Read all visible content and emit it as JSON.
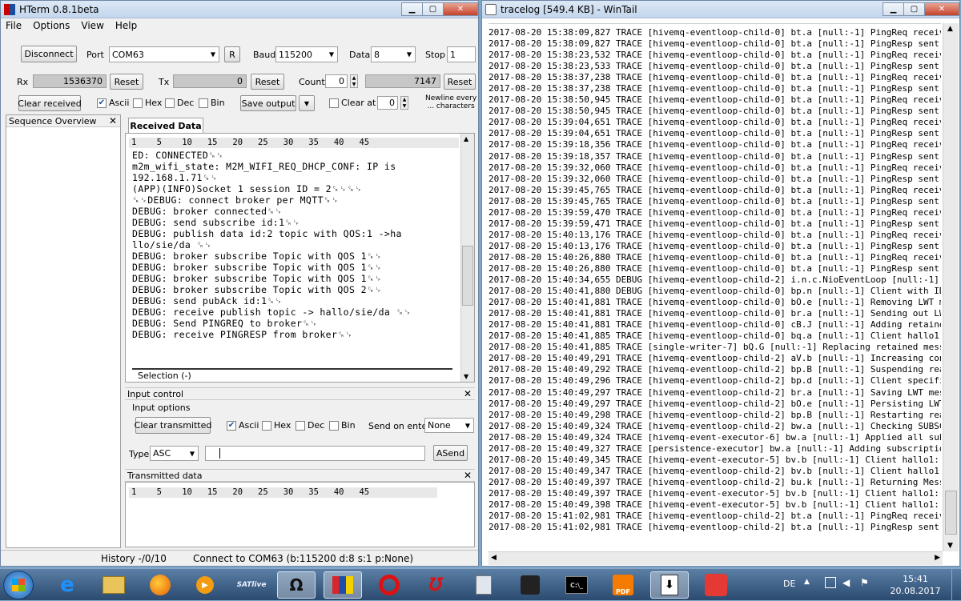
{
  "hterm": {
    "title": "HTerm 0.8.1beta",
    "menu": [
      "File",
      "Options",
      "View",
      "Help"
    ],
    "conn": {
      "disconnect_label": "Disconnect",
      "port_label": "Port",
      "port_value": "COM63",
      "r_label": "R",
      "baud_label": "Baud",
      "baud_value": "115200",
      "data_label": "Data",
      "data_value": "8",
      "stop_label": "Stop",
      "stop_value": "1"
    },
    "counters": {
      "rx_label": "Rx",
      "rx_value": "1536370",
      "rx_reset": "Reset",
      "tx_label": "Tx",
      "tx_value": "0",
      "tx_reset": "Reset",
      "count_label": "Count",
      "count_value": "0",
      "count_total": "7147",
      "count_reset": "Reset"
    },
    "rxopts": {
      "clear_received": "Clear received",
      "ascii": "Ascii",
      "hex": "Hex",
      "dec": "Dec",
      "bin": "Bin",
      "save_output": "Save output",
      "clear_at": "Clear at",
      "clear_at_value": "0",
      "newline_1": "Newline every",
      "newline_2": "... characters"
    },
    "sequence_overview": "Sequence Overview",
    "received_tab": "Received Data",
    "ruler": "1    5    10   15   20   25   30   35   40   45",
    "received_lines": [
      "ED: CONNECTED␍␊",
      "m2m_wifi_state: M2M_WIFI_REQ_DHCP_CONF: IP is",
      "192.168.1.71␍␊",
      "(APP)(INFO)Socket 1 session ID = 2␍␊␍␊",
      "␍␊DEBUG: connect broker per MQTT␍␊",
      "DEBUG: broker connected␍␊",
      "DEBUG: send subscribe id:1␍␊",
      "DEBUG: publish data id:2 topic with QOS:1 ->ha",
      "llo/sie/da ␍␊",
      "DEBUG: broker subscribe Topic with QOS 1␍␊",
      "DEBUG: broker subscribe Topic with QOS 1␍␊",
      "DEBUG: broker subscribe Topic with QOS 1␍␊",
      "DEBUG: broker subscribe Topic with QOS 2␍␊",
      "DEBUG: send pubAck id:1␍␊",
      "DEBUG: receive publish topic -> hallo/sie/da ␍␊",
      "DEBUG: Send PINGREQ to broker␍␊",
      "DEBUG: receive PINGRESP from broker␍␊"
    ],
    "selection": "Selection (-)",
    "input_control": "Input control",
    "input_options": "Input options",
    "clear_transmitted": "Clear transmitted",
    "in_ascii": "Ascii",
    "in_hex": "Hex",
    "in_dec": "Dec",
    "in_bin": "Bin",
    "send_on_enter": "Send on enter",
    "send_on_enter_value": "None",
    "type_label": "Type",
    "type_value": "ASC",
    "asend": "ASend",
    "transmitted_data": "Transmitted data",
    "status_history": "History -/0/10",
    "status_connect": "Connect to COM63 (b:115200 d:8 s:1 p:None)"
  },
  "wintail": {
    "title": "tracelog [549.4 KB] - WinTail",
    "lines": [
      "2017-08-20 15:38:09,827 TRACE [hivemq-eventloop-child-0] bt.a [null:-1] PingReq received",
      "2017-08-20 15:38:09,827 TRACE [hivemq-eventloop-child-0] bt.a [null:-1] PingResp sent",
      "2017-08-20 15:38:23,532 TRACE [hivemq-eventloop-child-0] bt.a [null:-1] PingReq received",
      "2017-08-20 15:38:23,533 TRACE [hivemq-eventloop-child-0] bt.a [null:-1] PingResp sent",
      "2017-08-20 15:38:37,238 TRACE [hivemq-eventloop-child-0] bt.a [null:-1] PingReq received",
      "2017-08-20 15:38:37,238 TRACE [hivemq-eventloop-child-0] bt.a [null:-1] PingResp sent",
      "2017-08-20 15:38:50,945 TRACE [hivemq-eventloop-child-0] bt.a [null:-1] PingReq received",
      "2017-08-20 15:38:50,945 TRACE [hivemq-eventloop-child-0] bt.a [null:-1] PingResp sent",
      "2017-08-20 15:39:04,651 TRACE [hivemq-eventloop-child-0] bt.a [null:-1] PingReq received",
      "2017-08-20 15:39:04,651 TRACE [hivemq-eventloop-child-0] bt.a [null:-1] PingResp sent",
      "2017-08-20 15:39:18,356 TRACE [hivemq-eventloop-child-0] bt.a [null:-1] PingReq received",
      "2017-08-20 15:39:18,357 TRACE [hivemq-eventloop-child-0] bt.a [null:-1] PingResp sent",
      "2017-08-20 15:39:32,060 TRACE [hivemq-eventloop-child-0] bt.a [null:-1] PingReq received",
      "2017-08-20 15:39:32,060 TRACE [hivemq-eventloop-child-0] bt.a [null:-1] PingResp sent",
      "2017-08-20 15:39:45,765 TRACE [hivemq-eventloop-child-0] bt.a [null:-1] PingReq received",
      "2017-08-20 15:39:45,765 TRACE [hivemq-eventloop-child-0] bt.a [null:-1] PingResp sent",
      "2017-08-20 15:39:59,470 TRACE [hivemq-eventloop-child-0] bt.a [null:-1] PingReq received",
      "2017-08-20 15:39:59,471 TRACE [hivemq-eventloop-child-0] bt.a [null:-1] PingResp sent",
      "2017-08-20 15:40:13,176 TRACE [hivemq-eventloop-child-0] bt.a [null:-1] PingReq received",
      "2017-08-20 15:40:13,176 TRACE [hivemq-eventloop-child-0] bt.a [null:-1] PingResp sent",
      "2017-08-20 15:40:26,880 TRACE [hivemq-eventloop-child-0] bt.a [null:-1] PingReq received",
      "2017-08-20 15:40:26,880 TRACE [hivemq-eventloop-child-0] bt.a [null:-1] PingResp sent",
      "2017-08-20 15:40:34,655 DEBUG [hivemq-eventloop-child-2] i.n.c.NioEventLoop [null:-1]",
      "2017-08-20 15:40:41,880 DEBUG [hivemq-eventloop-child-0] bp.n [null:-1] Client with ID",
      "2017-08-20 15:40:41,881 TRACE [hivemq-eventloop-child-0] bO.e [null:-1] Removing LWT m",
      "2017-08-20 15:40:41,881 TRACE [hivemq-eventloop-child-0] br.a [null:-1] Sending out LW",
      "2017-08-20 15:40:41,881 TRACE [hivemq-eventloop-child-0] cB.J [null:-1] Adding retaine",
      "2017-08-20 15:40:41,885 TRACE [hivemq-eventloop-child-0] bq.a [null:-1] Client hallo1",
      "2017-08-20 15:40:41,885 TRACE [single-writer-7] bQ.G [null:-1] Replacing retained mess",
      "2017-08-20 15:40:49,291 TRACE [hivemq-eventloop-child-2] aV.b [null:-1] Increasing con",
      "2017-08-20 15:40:49,292 TRACE [hivemq-eventloop-child-2] bp.B [null:-1] Suspending rea",
      "2017-08-20 15:40:49,296 TRACE [hivemq-eventloop-child-2] bp.d [null:-1] Client specifi",
      "2017-08-20 15:40:49,297 TRACE [hivemq-eventloop-child-2] br.a [null:-1] Saving LWT mes",
      "2017-08-20 15:40:49,297 TRACE [hivemq-eventloop-child-2] bO.e [null:-1] Persisting LWT",
      "2017-08-20 15:40:49,298 TRACE [hivemq-eventloop-child-2] bp.B [null:-1] Restarting rea",
      "2017-08-20 15:40:49,324 TRACE [hivemq-eventloop-child-2] bw.a [null:-1] Checking SUBSC",
      "2017-08-20 15:40:49,324 TRACE [hivemq-event-executor-6] bw.a [null:-1] Applied all sub",
      "2017-08-20 15:40:49,327 TRACE [persistence-executor] bw.a [null:-1] Adding subscriptio",
      "2017-08-20 15:40:49,345 TRACE [hivemq-event-executor-5] bv.b [null:-1] Client hallo1:",
      "2017-08-20 15:40:49,347 TRACE [hivemq-eventloop-child-2] bv.b [null:-1] Client hallo1:",
      "2017-08-20 15:40:49,397 TRACE [hivemq-eventloop-child-2] bu.k [null:-1] Returning Mess",
      "2017-08-20 15:40:49,397 TRACE [hivemq-event-executor-5] bv.b [null:-1] Client hallo1:",
      "2017-08-20 15:40:49,398 TRACE [hivemq-event-executor-5] bv.b [null:-1] Client hallo1:",
      "2017-08-20 15:41:02,981 TRACE [hivemq-eventloop-child-2] bt.a [null:-1] PingReq receiv",
      "2017-08-20 15:41:02,981 TRACE [hivemq-eventloop-child-2] bt.a [null:-1] PingResp sent"
    ]
  },
  "taskbar": {
    "lang": "DE",
    "time": "15:41",
    "date": "20.08.2017",
    "app_label_sat": "SATlive",
    "app_label_omega": "Ω",
    "app_label_cmd": "C:\\_",
    "app_label_pdf": "PDF"
  },
  "colors": {
    "accent": "#1a4d9c",
    "taskbar": "#2b4a6f",
    "desktop": "#7fa6c6"
  }
}
